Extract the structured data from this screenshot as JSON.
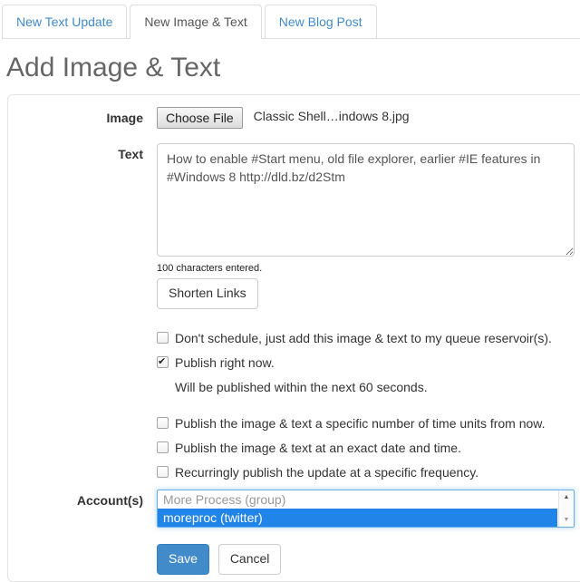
{
  "tabs": [
    {
      "label": "New Text Update",
      "active": false
    },
    {
      "label": "New Image & Text",
      "active": true
    },
    {
      "label": "New Blog Post",
      "active": false
    }
  ],
  "page_title": "Add Image & Text",
  "form": {
    "image_label": "Image",
    "choose_file_label": "Choose File",
    "file_name": "Classic Shell…indows 8.jpg",
    "text_label": "Text",
    "text_value": "How to enable #Start menu, old file explorer, earlier #IE features in #Windows 8 http://dld.bz/d2Stm",
    "char_count_text": "100 characters entered.",
    "shorten_links_label": "Shorten Links",
    "options": [
      {
        "label": "Don't schedule, just add this image & text to my queue reservoir(s).",
        "checked": false
      },
      {
        "label": "Publish right now.",
        "checked": true
      },
      {
        "label": "Publish the image & text a specific number of time units from now.",
        "checked": false
      },
      {
        "label": "Publish the image & text at an exact date and time.",
        "checked": false
      },
      {
        "label": "Recurringly publish the update at a specific frequency.",
        "checked": false
      }
    ],
    "publish_note": "Will be published within the next 60 seconds.",
    "accounts_label": "Account(s)",
    "accounts": [
      {
        "label": "More Process (group)",
        "selected": false
      },
      {
        "label": "moreproc (twitter)",
        "selected": true
      }
    ],
    "save_label": "Save",
    "cancel_label": "Cancel"
  },
  "icons": {
    "scroll_up": "▲",
    "scroll_down": "▼"
  },
  "colors": {
    "accent_blue": "#428bca",
    "tab_link": "#428bca",
    "active_tab_text": "#555555",
    "heading_gray": "#666666",
    "panel_border": "#e3e3e3",
    "select_focus_border": "#66afe9",
    "selected_option_bg": "#2184e8",
    "save_button_bg": "#428bca"
  }
}
